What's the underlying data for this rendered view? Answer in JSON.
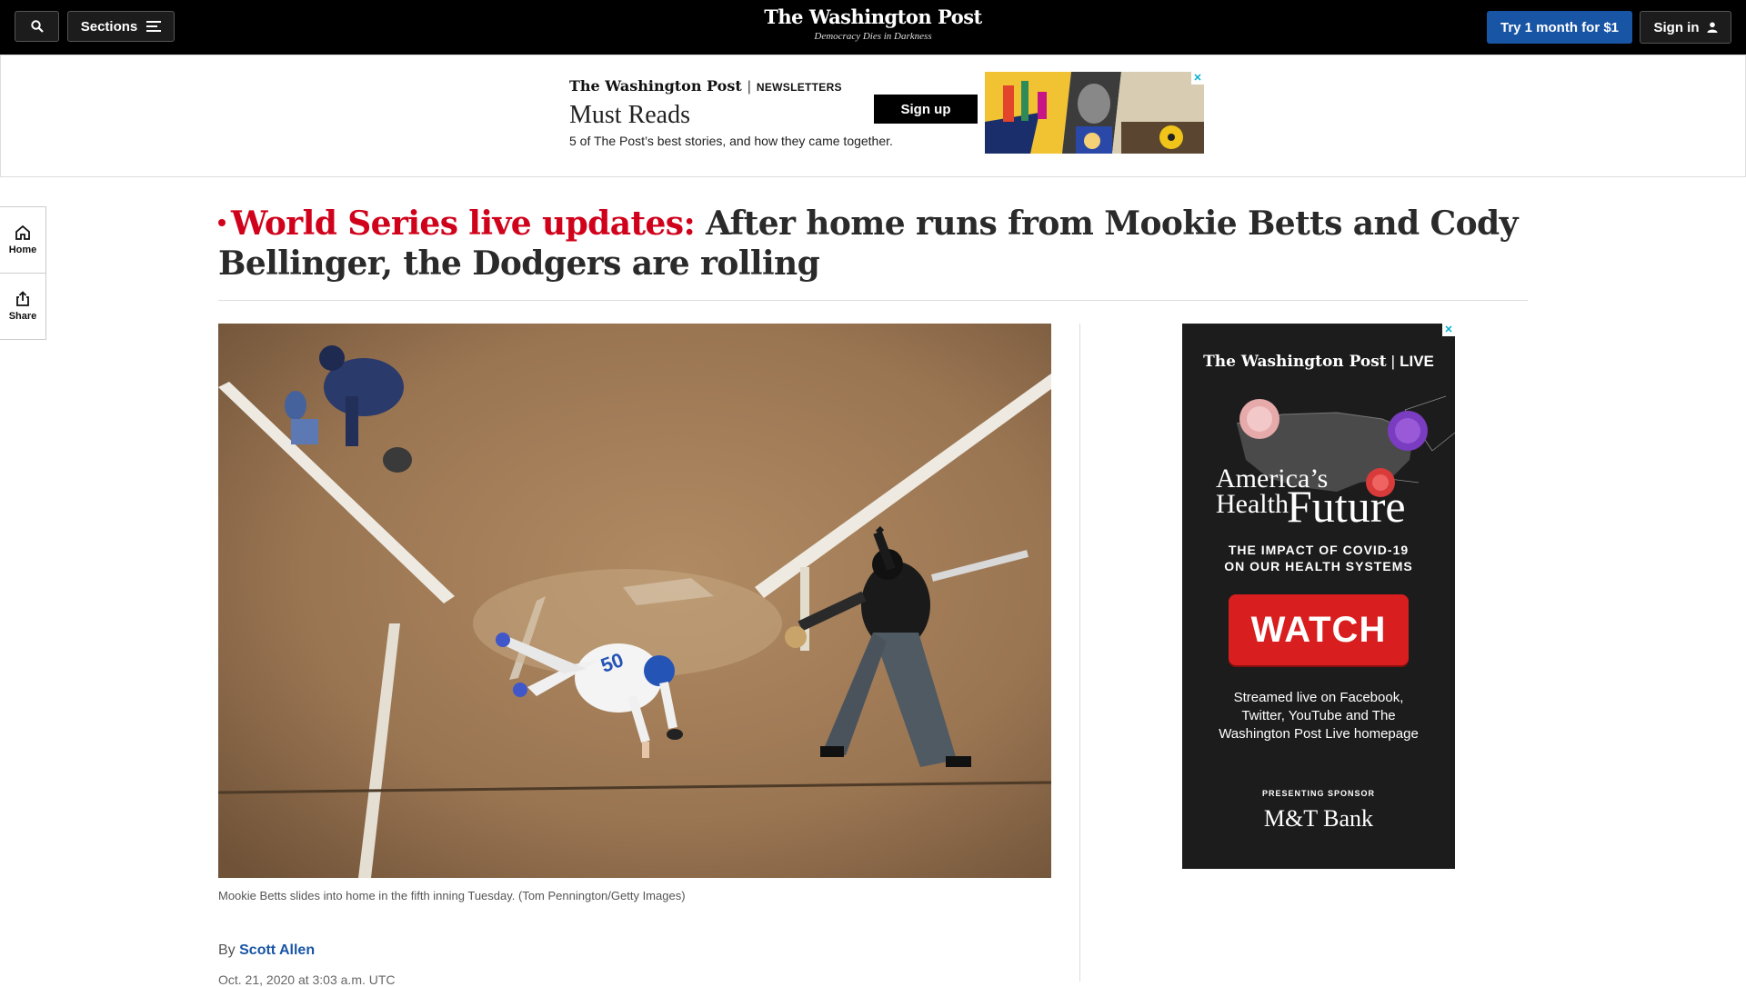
{
  "nav": {
    "sections_label": "Sections",
    "logo_title": "The Washington Post",
    "logo_tagline": "Democracy Dies in Darkness",
    "subscribe_label": "Try 1 month for $1",
    "signin_label": "Sign in"
  },
  "newsletter_ad": {
    "brand": "The Washington Post",
    "separator": "|",
    "category": "NEWSLETTERS",
    "title": "Must Reads",
    "description": "5 of The Post’s best stories, and how they came together.",
    "button_label": "Sign up"
  },
  "rail": {
    "home_label": "Home",
    "share_label": "Share"
  },
  "article": {
    "kicker": "World Series live updates:",
    "headline": "After home runs from Mookie Betts and Cody Bellinger, the Dodgers are rolling",
    "caption": "Mookie Betts slides into home in the fifth inning Tuesday. (Tom Pennington/Getty Images)",
    "byline_prefix": "By",
    "author": "Scott Allen",
    "dateline": "Oct. 21, 2020 at 3:03 a.m. UTC"
  },
  "live_ad": {
    "brand": "The Washington Post",
    "separator": "|",
    "brand_suffix": "LIVE",
    "title_line1": "America’s",
    "title_line2": "Health",
    "title_line3": "Future",
    "impact_line1": "THE IMPACT OF COVID-19",
    "impact_line2": "ON OUR HEALTH SYSTEMS",
    "button_label": "WATCH",
    "stream_text": "Streamed live on Facebook, Twitter, YouTube and The Washington Post Live homepage",
    "presenting_label": "PRESENTING SPONSOR",
    "sponsor": "M&T Bank"
  },
  "colors": {
    "nav_background": "#000000",
    "subscribe_blue": "#1955a5",
    "kicker_red": "#d0021b",
    "watch_red": "#d81e1e"
  },
  "icons": [
    "search-icon",
    "menu-icon",
    "user-icon",
    "home-icon",
    "share-icon",
    "ad-close-icon"
  ]
}
